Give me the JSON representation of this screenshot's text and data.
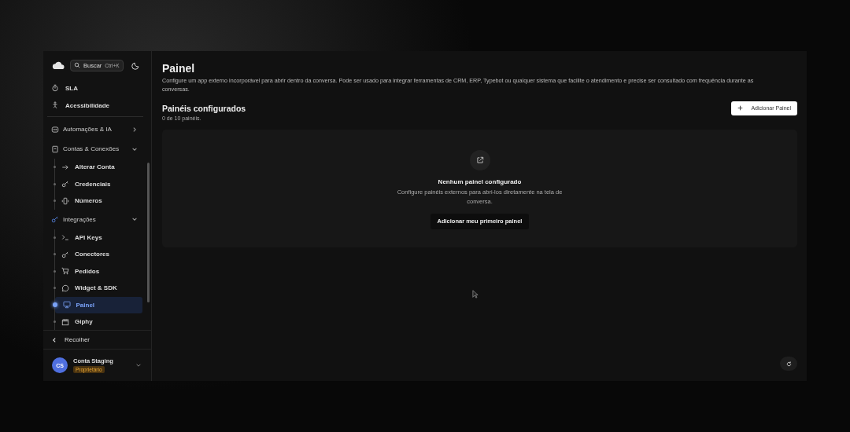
{
  "sidebar": {
    "search": {
      "label": "Buscar",
      "shortcut": "Ctrl+K"
    },
    "top_items": [
      {
        "label": "SLA",
        "selected": false
      },
      {
        "label": "Acessibilidade",
        "selected": false
      }
    ],
    "groups": [
      {
        "label": "Automações & IA",
        "expanded": false
      },
      {
        "label": "Contas & Conexões",
        "expanded": true,
        "children": [
          {
            "label": "Alterar Conta",
            "selected": false
          },
          {
            "label": "Credenciais",
            "selected": false
          },
          {
            "label": "Números",
            "selected": false
          }
        ]
      },
      {
        "label": "Integrações",
        "expanded": true,
        "children": [
          {
            "label": "API Keys",
            "selected": false
          },
          {
            "label": "Conectores",
            "selected": false
          },
          {
            "label": "Pedidos",
            "selected": false
          },
          {
            "label": "Widget & SDK",
            "selected": false
          },
          {
            "label": "Painel",
            "selected": true
          },
          {
            "label": "Giphy",
            "selected": false
          }
        ]
      }
    ],
    "collapse": "Recolher",
    "account": {
      "initials": "CS",
      "name": "Conta Staging",
      "role": "Proprietário"
    }
  },
  "page": {
    "title": "Painel",
    "description": "Configure um app externo incorporável para abrir dentro da conversa. Pode ser usado para integrar ferramentas de CRM, ERP, Typebot ou qualquer sistema que facilite o atendimento e precise ser consultado com frequência durante as conversas.",
    "section_title": "Painéis configurados",
    "count": "0 de 10 painéis.",
    "add_button": "Adicionar Painel",
    "empty": {
      "title": "Nenhum painel configurado",
      "text": "Configure painéis externos para abri-los diretamente na tela de conversa.",
      "button": "Adicionar meu primeiro painel"
    }
  }
}
